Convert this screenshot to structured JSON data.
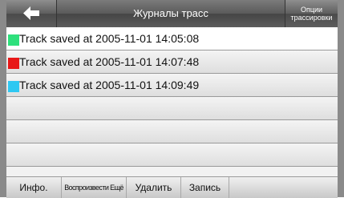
{
  "header": {
    "title": "Журналы трасс",
    "options_line1": "Опции",
    "options_line2": "трассировки"
  },
  "tracks": [
    {
      "label": "Track saved at 2005-11-01 14:05:08",
      "color": "#2ee07c"
    },
    {
      "label": "Track saved at 2005-11-01 14:07:48",
      "color": "#e81717"
    },
    {
      "label": "Track saved at 2005-11-01 14:09:49",
      "color": "#2ec8f2"
    }
  ],
  "toolbar": {
    "info": "Инфо.",
    "replay_more": "Воспроизвести Ещё",
    "delete": "Удалить",
    "record": "Запись"
  }
}
